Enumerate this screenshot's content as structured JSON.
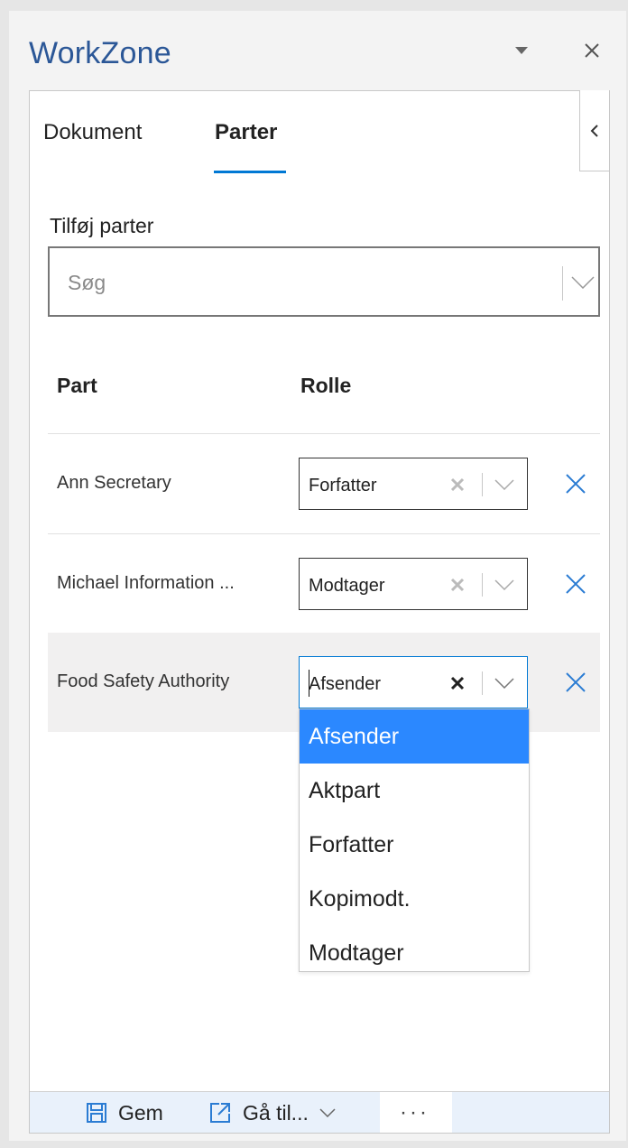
{
  "app": {
    "title": "WorkZone"
  },
  "header": {
    "menu_icon": "caret-down-icon",
    "close_icon": "close-icon"
  },
  "panel": {
    "collapse_icon": "chevron-left-icon"
  },
  "tabs": [
    {
      "label": "Dokument",
      "active": false
    },
    {
      "label": "Parter",
      "active": true
    }
  ],
  "add_parties": {
    "label": "Tilføj parter",
    "search_placeholder": "Søg",
    "search_value": ""
  },
  "table": {
    "headers": {
      "part": "Part",
      "rolle": "Rolle"
    },
    "rows": [
      {
        "name": "Ann Secretary",
        "role": "Forfatter"
      },
      {
        "name": "Michael Information ...",
        "role": "Modtager"
      },
      {
        "name": "Food Safety Authority",
        "role": "Afsender"
      }
    ]
  },
  "role_dropdown": {
    "options": [
      "Afsender",
      "Aktpart",
      "Forfatter",
      "Kopimodt.",
      "Modtager"
    ],
    "selected": "Afsender"
  },
  "footer": {
    "save_label": "Gem",
    "goto_label": "Gå til...",
    "more_label": "···"
  },
  "colors": {
    "accent": "#0078d4",
    "title": "#2b5797",
    "selection": "#2b88ff",
    "footer_bg": "#e9f1fb"
  }
}
